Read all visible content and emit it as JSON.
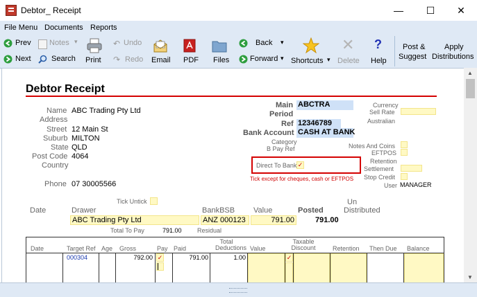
{
  "window": {
    "title": "Debtor_ Receipt",
    "minimize": "—",
    "maximize": "☐",
    "close": "✕"
  },
  "menu": [
    "File Menu",
    "Documents",
    "Reports"
  ],
  "toolbar": {
    "prev": "Prev",
    "next": "Next",
    "notes": "Notes",
    "search": "Search",
    "print": "Print",
    "undo": "Undo",
    "redo": "Redo",
    "email": "Email",
    "pdf": "PDF",
    "files": "Files",
    "back": "Back",
    "forward": "Forward",
    "shortcuts": "Shortcuts",
    "delete": "Delete",
    "help": "Help",
    "post_suggest_1": "Post &",
    "post_suggest_2": "Suggest",
    "apply_dist_1": "Apply",
    "apply_dist_2": "Distributions"
  },
  "doc": {
    "heading": "Debtor Receipt",
    "labels": {
      "name": "Name",
      "address": "Address",
      "street": "Street",
      "suburb": "Suburb",
      "state": "State",
      "postcode": "Post Code",
      "country": "Country",
      "phone": "Phone",
      "main": "Main",
      "period": "Period",
      "ref": "Ref",
      "bank_account": "Bank Account",
      "category": "Category",
      "bpay_ref": "B Pay Ref",
      "currency": "Currency",
      "sell_rate": "Sell Rate",
      "australian": "Australian",
      "notes_coins": "Notes And Coins",
      "eftpos": "EFTPOS",
      "retention": "Retention",
      "settlement": "Settlement",
      "stop_credit": "Stop Credit",
      "user": "User",
      "direct_to_bank": "Direct To Bank",
      "tick_note": "Tick except for cheques, cash or EFTPOS",
      "tick_untick": "Tick Untick",
      "date": "Date",
      "drawer": "Drawer",
      "bankbsb": "BankBSB",
      "value": "Value",
      "posted": "Posted",
      "un": "Un",
      "distributed": "Distributed",
      "total_to_pay": "Total To Pay",
      "residual": "Residual"
    },
    "values": {
      "name": "ABC Trading Pty Ltd",
      "street": "12 Main St",
      "suburb": "MILTON",
      "state": "QLD",
      "postcode": "4064",
      "phone": "07 30005566",
      "main": "ABCTRA",
      "ref": "12346789",
      "bank_account": "CASH AT BANK",
      "user": "MANAGER",
      "direct_to_bank_check": "✓",
      "drawer": "ABC Trading Pty Ltd",
      "bankbsb": "ANZ 000123",
      "value": "791.00",
      "posted": "791.00",
      "total_to_pay": "791.00"
    },
    "table": {
      "headers": [
        "Date",
        "Target Ref",
        "Age",
        "Gross",
        "Pay",
        "Paid",
        "Total Deductions",
        "Value",
        "Taxable Discount",
        "Retention",
        "Then Due",
        "Balance"
      ],
      "rows": [
        {
          "date": "",
          "target_ref": "000304",
          "age": "",
          "gross": "792.00",
          "pay": "✓",
          "paid": "791.00",
          "total_deductions": "1.00",
          "value": "",
          "taxable": "✓",
          "discount": "",
          "retention": "",
          "then_due": "",
          "balance": ""
        }
      ]
    }
  }
}
